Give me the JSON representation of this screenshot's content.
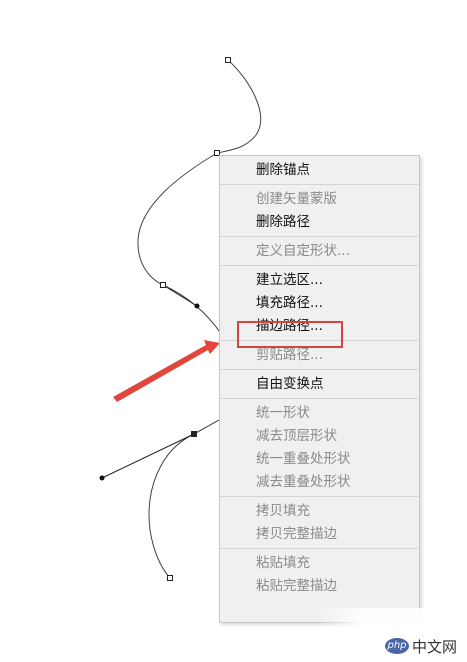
{
  "menu": {
    "groups": [
      [
        {
          "label": "删除锚点",
          "enabled": true
        }
      ],
      [
        {
          "label": "创建矢量蒙版",
          "enabled": false
        },
        {
          "label": "删除路径",
          "enabled": true
        }
      ],
      [
        {
          "label": "定义自定形状...",
          "enabled": false
        }
      ],
      [
        {
          "label": "建立选区...",
          "enabled": true
        },
        {
          "label": "填充路径...",
          "enabled": true
        },
        {
          "label": "描边路径...",
          "enabled": true,
          "highlighted": true
        }
      ],
      [
        {
          "label": "剪贴路径...",
          "enabled": false
        }
      ],
      [
        {
          "label": "自由变换点",
          "enabled": true
        }
      ],
      [
        {
          "label": "统一形状",
          "enabled": false
        },
        {
          "label": "减去顶层形状",
          "enabled": false
        },
        {
          "label": "统一重叠处形状",
          "enabled": false
        },
        {
          "label": "减去重叠处形状",
          "enabled": false
        }
      ],
      [
        {
          "label": "拷贝填充",
          "enabled": false
        },
        {
          "label": "拷贝完整描边",
          "enabled": false
        }
      ],
      [
        {
          "label": "粘贴填充",
          "enabled": false
        },
        {
          "label": "粘贴完整描边",
          "enabled": false
        }
      ]
    ]
  },
  "colors": {
    "arrow": "#e0463c",
    "highlight": "#d6453c",
    "menu_bg": "#f0f0f0",
    "path": "#333333"
  },
  "watermark": {
    "logo": "php",
    "text": "中文网"
  }
}
